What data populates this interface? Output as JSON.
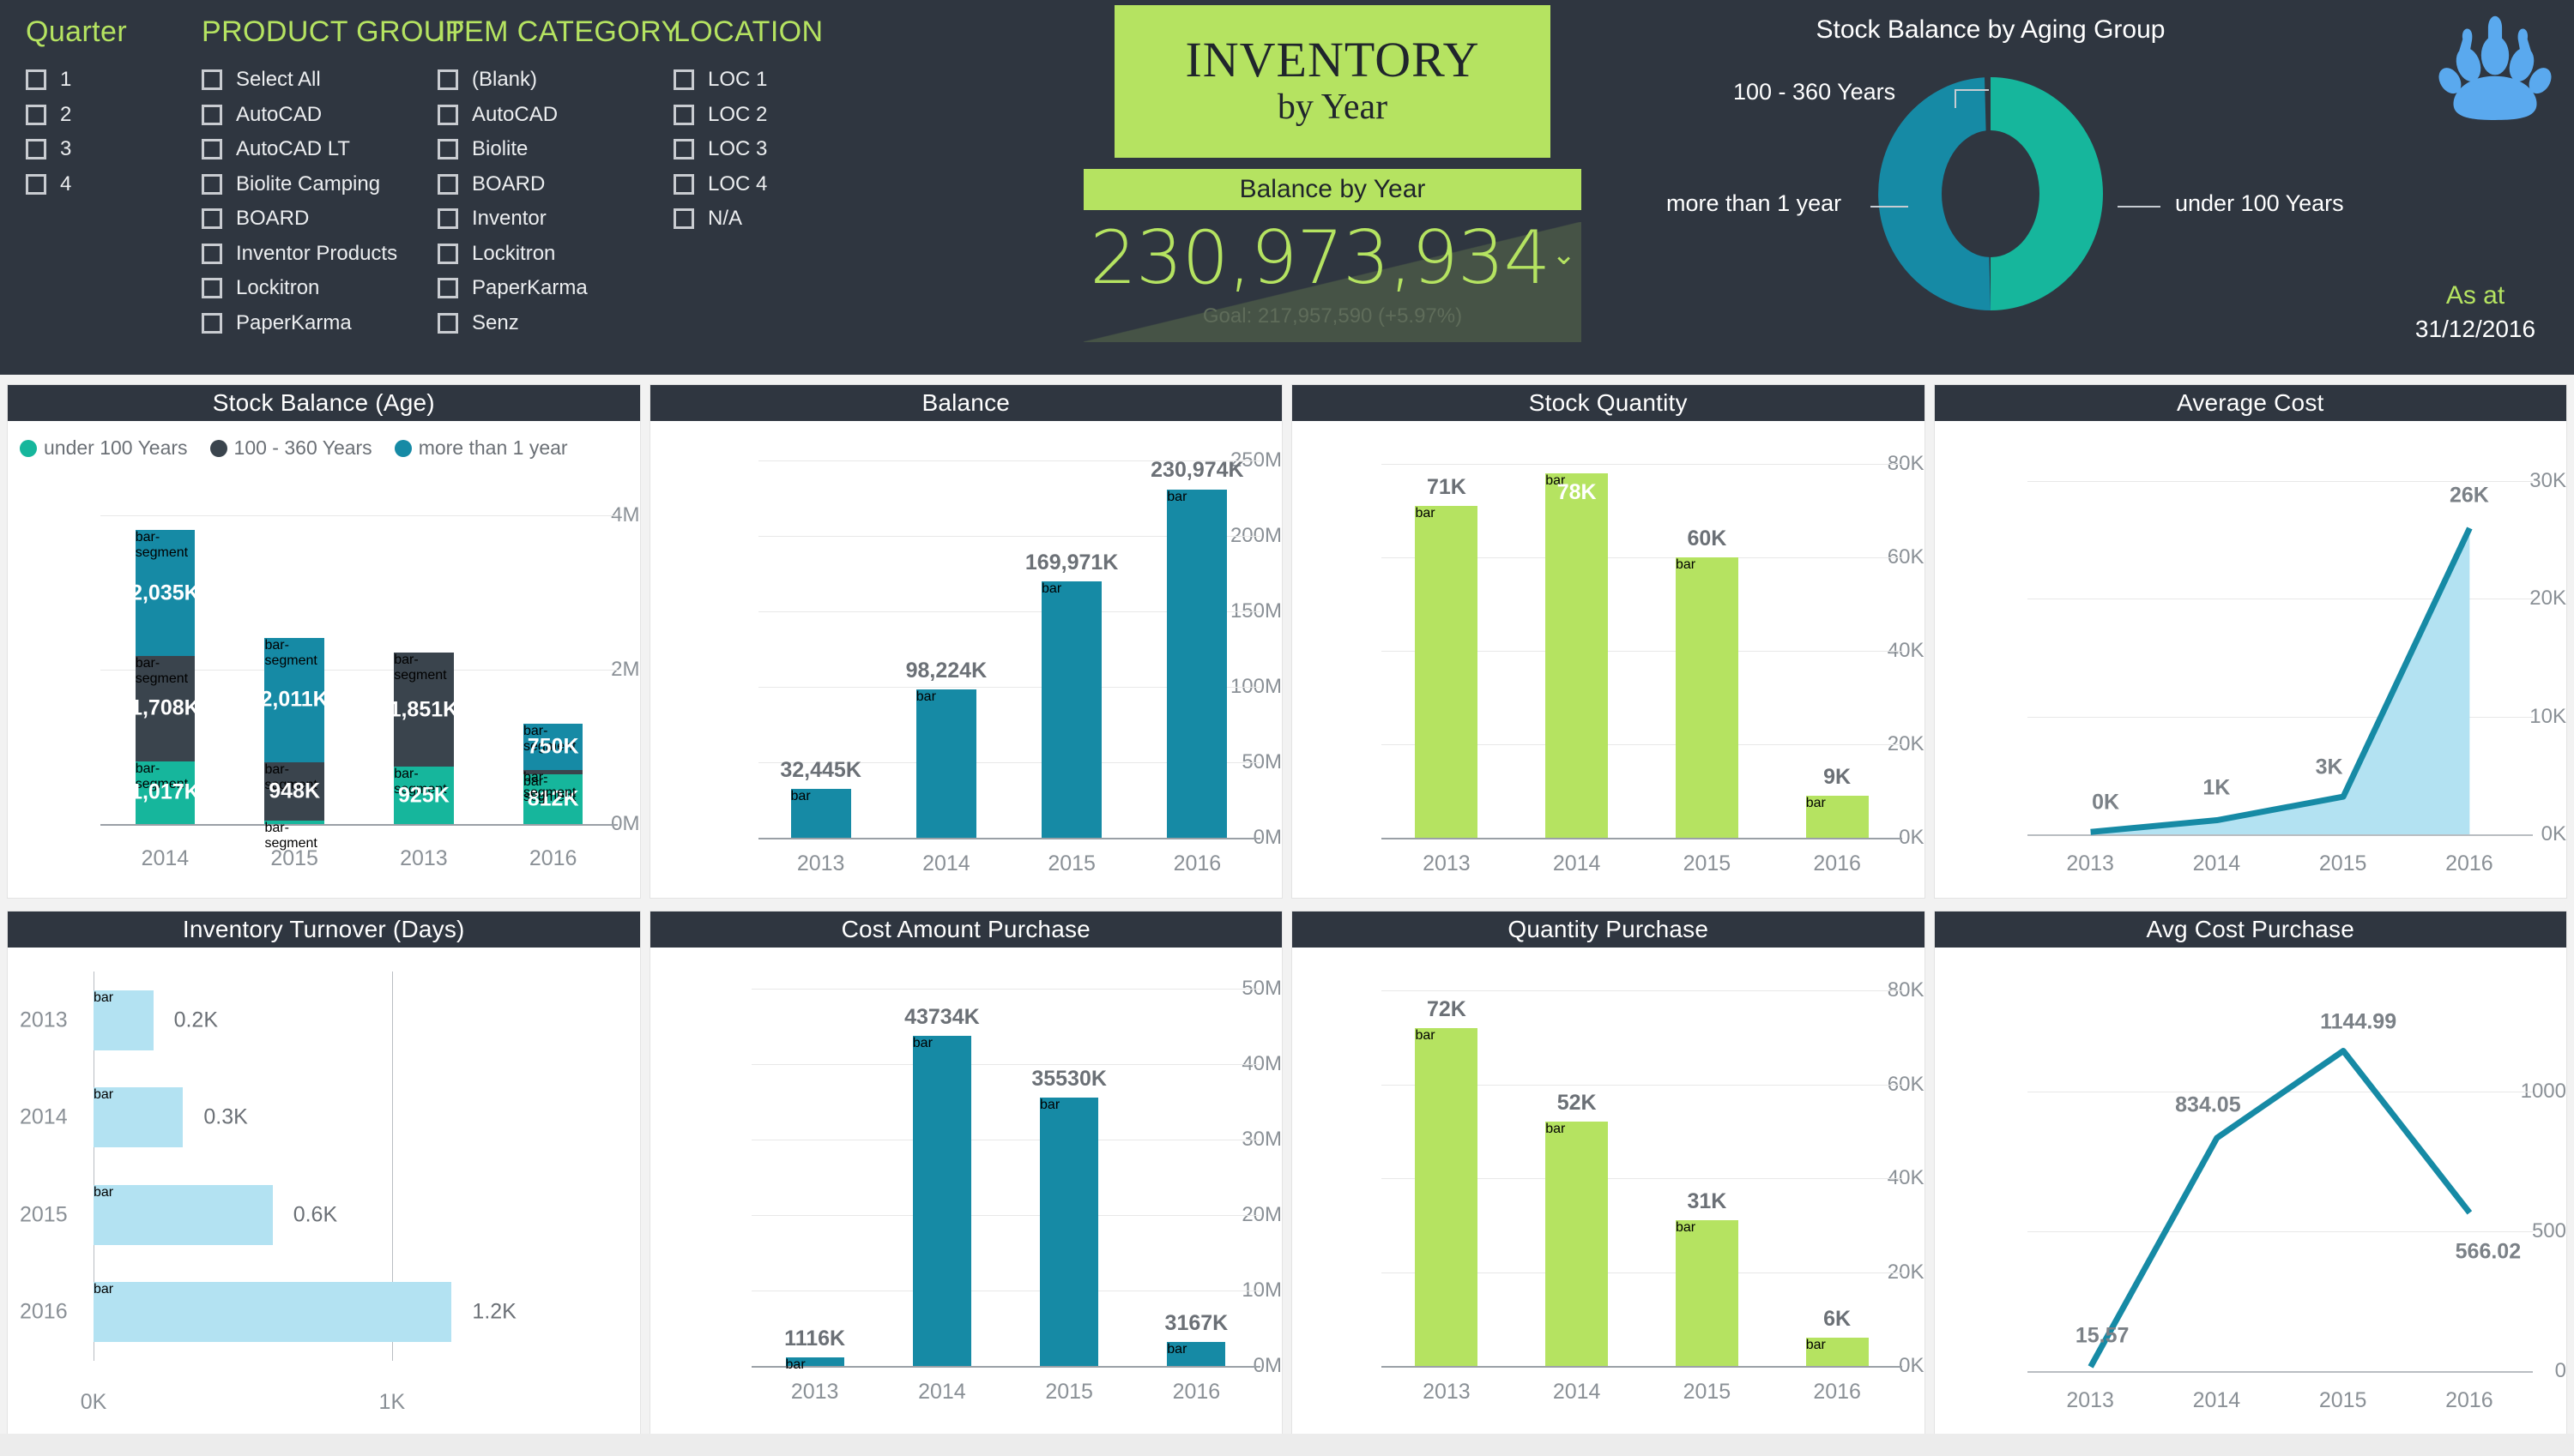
{
  "theme": {
    "dark": "#2f3640",
    "green": "#b5e361",
    "teal": "#16b69c",
    "blue": "#168aa5",
    "lightblue": "#b3e2f2",
    "slate": "#3a444d"
  },
  "header": {
    "slicers": [
      {
        "title": "Quarter",
        "items": [
          "1",
          "2",
          "3",
          "4"
        ]
      },
      {
        "title": "PRODUCT GROUP",
        "items": [
          "Select All",
          "AutoCAD",
          "AutoCAD LT",
          "Biolite Camping",
          "BOARD",
          "Inventor Products",
          "Lockitron",
          "PaperKarma"
        ]
      },
      {
        "title": "ITEM CATEGORY",
        "items": [
          "(Blank)",
          "AutoCAD",
          "Biolite",
          "BOARD",
          "Inventor",
          "Lockitron",
          "PaperKarma",
          "Senz"
        ]
      },
      {
        "title": "LOCATION",
        "items": [
          "LOC 1",
          "LOC 2",
          "LOC 3",
          "LOC 4",
          "N/A"
        ]
      }
    ],
    "kpi": {
      "title_main": "INVENTORY",
      "title_sub": "by Year",
      "band_label": "Balance by Year",
      "value": "230,973,934",
      "caret": "⌄",
      "goal": "Goal: 217,957,590 (+5.97%)"
    },
    "asat": {
      "label": "As at",
      "date": "31/12/2016"
    },
    "logo": "paw-print-icon"
  },
  "chart_data": [
    {
      "id": "aging-donut",
      "type": "pie",
      "title": "Stock Balance by Aging Group",
      "legend_position": "callout",
      "categories": [
        "under 100 Years",
        "more than 1 year",
        "100 - 360 Years"
      ],
      "values": [
        50,
        48,
        2
      ],
      "colors": [
        "#16b69c",
        "#168aa5",
        "#3a444d"
      ],
      "labels": {
        "top": "100 - 360 Years",
        "left": "more than 1 year",
        "right": "under 100 Years"
      }
    },
    {
      "id": "stock-balance-age",
      "type": "bar",
      "title": "Stock Balance (Age)",
      "stacked": true,
      "categories": [
        "2014",
        "2015",
        "2013",
        "2016"
      ],
      "ylabel": "",
      "yticks": [
        "0M",
        "2M",
        "4M"
      ],
      "ylim": [
        0,
        5000
      ],
      "series": [
        {
          "name": "under 100 Years",
          "color": "#16b69c",
          "values": [
            1017,
            55,
            925,
            812
          ],
          "labels": [
            "1,017K",
            "",
            "925K",
            "812K"
          ]
        },
        {
          "name": "100 - 360 Years",
          "color": "#3a444d",
          "values": [
            1708,
            948,
            1851,
            60
          ],
          "labels": [
            "1,708K",
            "948K",
            "1,851K",
            ""
          ]
        },
        {
          "name": "more than 1 year",
          "color": "#168aa5",
          "values": [
            2035,
            2011,
            0,
            750
          ],
          "labels": [
            "2,035K",
            "2,011K",
            "",
            "750K"
          ]
        }
      ],
      "legend": [
        {
          "label": "under 100 Years",
          "color": "#16b69c"
        },
        {
          "label": "100 - 360 Years",
          "color": "#3a444d"
        },
        {
          "label": "more than 1 year",
          "color": "#168aa5"
        }
      ]
    },
    {
      "id": "balance",
      "type": "bar",
      "title": "Balance",
      "categories": [
        "2013",
        "2014",
        "2015",
        "2016"
      ],
      "values": [
        32445,
        98224,
        169971,
        230974
      ],
      "labels": [
        "32,445K",
        "98,224K",
        "169,971K",
        "230,974K"
      ],
      "yticks": [
        "0M",
        "50M",
        "100M",
        "150M",
        "200M",
        "250M"
      ],
      "ylim": [
        0,
        250000
      ],
      "color": "#168aa5"
    },
    {
      "id": "stock-quantity",
      "type": "bar",
      "title": "Stock Quantity",
      "categories": [
        "2013",
        "2014",
        "2015",
        "2016"
      ],
      "values": [
        71,
        78,
        60,
        9
      ],
      "labels": [
        "71K",
        "78K",
        "60K",
        "9K"
      ],
      "yticks": [
        "0K",
        "20K",
        "40K",
        "60K",
        "80K"
      ],
      "ylim": [
        0,
        80
      ],
      "color": "#b5e361"
    },
    {
      "id": "average-cost",
      "type": "area",
      "title": "Average Cost",
      "categories": [
        "2013",
        "2014",
        "2015",
        "2016"
      ],
      "values": [
        0.2,
        1.2,
        3.2,
        26
      ],
      "labels": [
        "0K",
        "1K",
        "3K",
        "26K"
      ],
      "yticks": [
        "0K",
        "10K",
        "20K",
        "30K"
      ],
      "ylim": [
        0,
        30
      ],
      "color": "#168aa5",
      "fill": "#b3e2f2"
    },
    {
      "id": "inventory-turnover",
      "type": "bar",
      "title": "Inventory Turnover (Days)",
      "orientation": "horizontal",
      "categories": [
        "2013",
        "2014",
        "2015",
        "2016"
      ],
      "values": [
        0.2,
        0.3,
        0.6,
        1.2
      ],
      "labels": [
        "0.2K",
        "0.3K",
        "0.6K",
        "1.2K"
      ],
      "xticks": [
        "0K",
        "1K"
      ],
      "xlim": [
        0,
        1.4
      ],
      "color": "#b3e2f2"
    },
    {
      "id": "cost-amount-purchase",
      "type": "bar",
      "title": "Cost Amount Purchase",
      "categories": [
        "2013",
        "2014",
        "2015",
        "2016"
      ],
      "values": [
        1116,
        43734,
        35530,
        3167
      ],
      "labels": [
        "1116K",
        "43734K",
        "35530K",
        "3167K"
      ],
      "yticks": [
        "0M",
        "10M",
        "20M",
        "30M",
        "40M",
        "50M"
      ],
      "ylim": [
        0,
        50000
      ],
      "color": "#168aa5"
    },
    {
      "id": "quantity-purchase",
      "type": "bar",
      "title": "Quantity Purchase",
      "categories": [
        "2013",
        "2014",
        "2015",
        "2016"
      ],
      "values": [
        72,
        52,
        31,
        6
      ],
      "labels": [
        "72K",
        "52K",
        "31K",
        "6K"
      ],
      "yticks": [
        "0K",
        "20K",
        "40K",
        "60K",
        "80K"
      ],
      "ylim": [
        0,
        80
      ],
      "color": "#b5e361"
    },
    {
      "id": "avg-cost-purchase",
      "type": "line",
      "title": "Avg Cost Purchase",
      "categories": [
        "2013",
        "2014",
        "2015",
        "2016"
      ],
      "values": [
        15.57,
        834.05,
        1144.99,
        566.02
      ],
      "labels": [
        "15.57",
        "834.05",
        "1144.99",
        "566.02"
      ],
      "yticks": [
        "0",
        "500",
        "1000"
      ],
      "ylim": [
        0,
        1300
      ],
      "color": "#168aa5"
    }
  ]
}
